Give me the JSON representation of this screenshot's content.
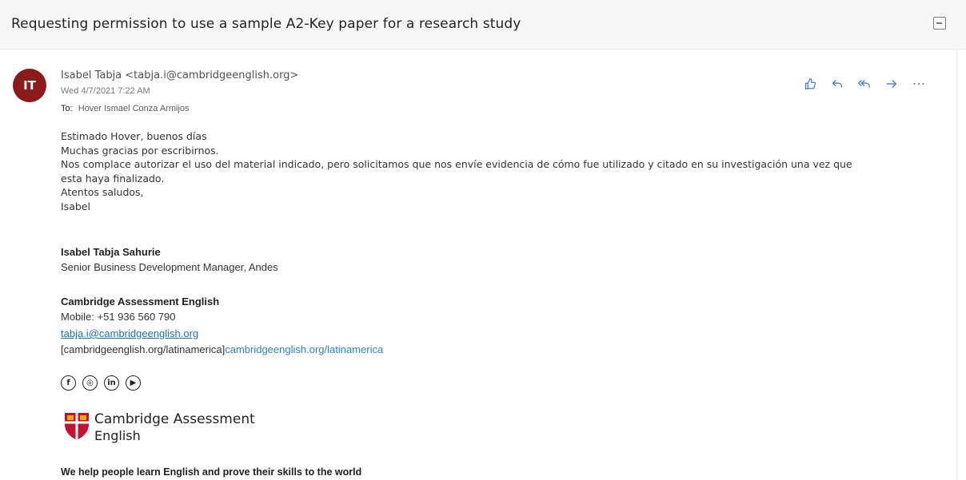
{
  "subject": "Requesting permission to use a sample A2-Key paper for a research study",
  "message": {
    "avatar_initials": "IT",
    "avatar_color": "#8b1a1a",
    "sender": "Isabel Tabja <tabja.i@cambridgeenglish.org>",
    "date": "Wed 4/7/2021 7:22 AM",
    "to_label": "To:",
    "to_name": "Hover Ismael Conza Armijos",
    "actions": [
      "like-icon",
      "reply-icon",
      "reply-all-icon",
      "forward-icon",
      "more-icon"
    ]
  },
  "body": {
    "lines": [
      "Estimado Hover, buenos días",
      "Muchas gracias por escribirnos.",
      "Nos complace autorizar el uso del material indicado, pero solicitamos que nos envíe evidencia de cómo fue utilizado y citado en su investigación una vez que",
      "esta haya finalizado.",
      "Atentos saludos,",
      "Isabel"
    ]
  },
  "signature": {
    "name": "Isabel Tabja Sahurie",
    "role": "Senior Business Development Manager, Andes",
    "org": "Cambridge Assessment English",
    "mobile": "Mobile: +51 936 560 790",
    "email": "tabja.i@cambridgeenglish.org",
    "web_text": "[cambridgeenglish.org/latinamerica]",
    "web_link": "cambridgeenglish.org/latinamerica",
    "social": [
      {
        "name": "facebook-icon",
        "glyph": "f"
      },
      {
        "name": "instagram-icon",
        "glyph": "◎"
      },
      {
        "name": "linkedin-icon",
        "glyph": "in"
      },
      {
        "name": "youtube-icon",
        "glyph": "▶"
      }
    ],
    "logo_line1": "Cambridge Assessment",
    "logo_line2": "English",
    "tagline": "We help people learn English and prove their skills to the world"
  }
}
